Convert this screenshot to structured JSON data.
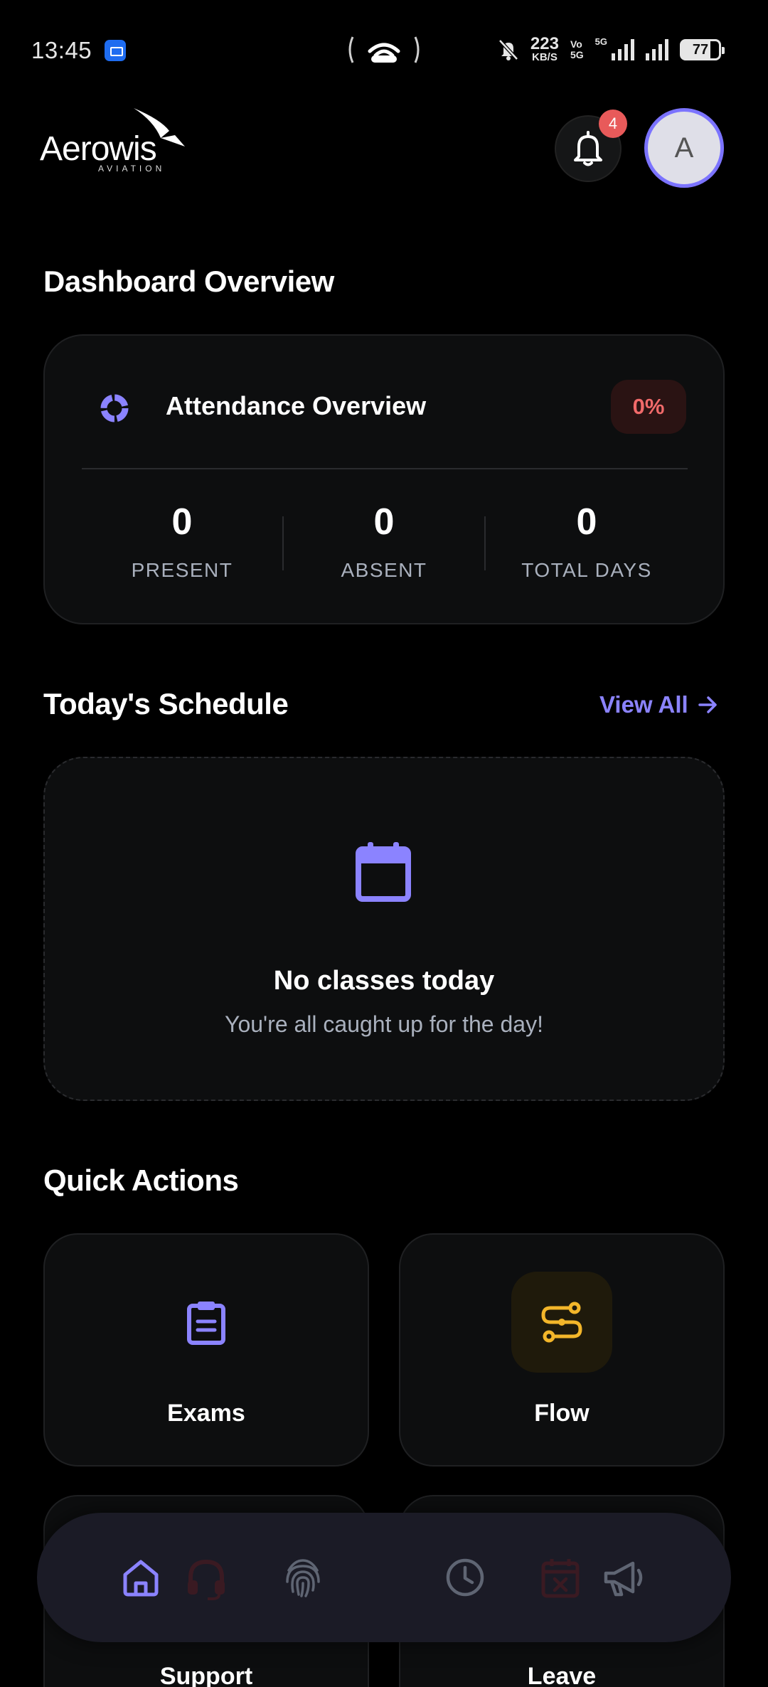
{
  "status_bar": {
    "time": "13:45",
    "speed_value": "223",
    "speed_unit": "KB/S",
    "volte_top": "Vo",
    "volte_bottom": "5G",
    "network_type": "5G",
    "battery": "77",
    "icons": [
      "app-icon",
      "hotspot-icon",
      "mute-icon",
      "signal-icon",
      "signal-icon",
      "battery-icon"
    ]
  },
  "header": {
    "logo_text": "Aerowis",
    "logo_subtext": "AVIATION",
    "notification_count": "4",
    "avatar_initial": "A"
  },
  "dashboard": {
    "section_title": "Dashboard Overview",
    "attendance": {
      "title": "Attendance Overview",
      "percentage": "0%",
      "stats": [
        {
          "value": "0",
          "label": "PRESENT"
        },
        {
          "value": "0",
          "label": "ABSENT"
        },
        {
          "value": "0",
          "label": "TOTAL DAYS"
        }
      ]
    }
  },
  "schedule": {
    "section_title": "Today's Schedule",
    "view_all": "View All",
    "empty_title": "No classes today",
    "empty_subtitle": "You're all caught up for the day!"
  },
  "quick_actions": {
    "section_title": "Quick Actions",
    "items": [
      {
        "label": "Exams",
        "icon": "clipboard-icon",
        "color": "#8b83ff"
      },
      {
        "label": "Flow",
        "icon": "flow-icon",
        "color": "#f3b62a"
      },
      {
        "label": "Support",
        "icon": "headset-icon"
      },
      {
        "label": "Leave",
        "icon": "calendar-x-icon"
      }
    ]
  },
  "bottom_nav": {
    "items": [
      "home-icon",
      "headset-icon",
      "fingerprint-icon",
      "clock-icon",
      "calendar-x-icon",
      "megaphone-icon"
    ],
    "active": "home-icon"
  },
  "colors": {
    "accent": "#8b83ff",
    "danger": "#f06a6a",
    "warning": "#f3b62a",
    "background": "#000000",
    "card": "#0d0e0f"
  }
}
